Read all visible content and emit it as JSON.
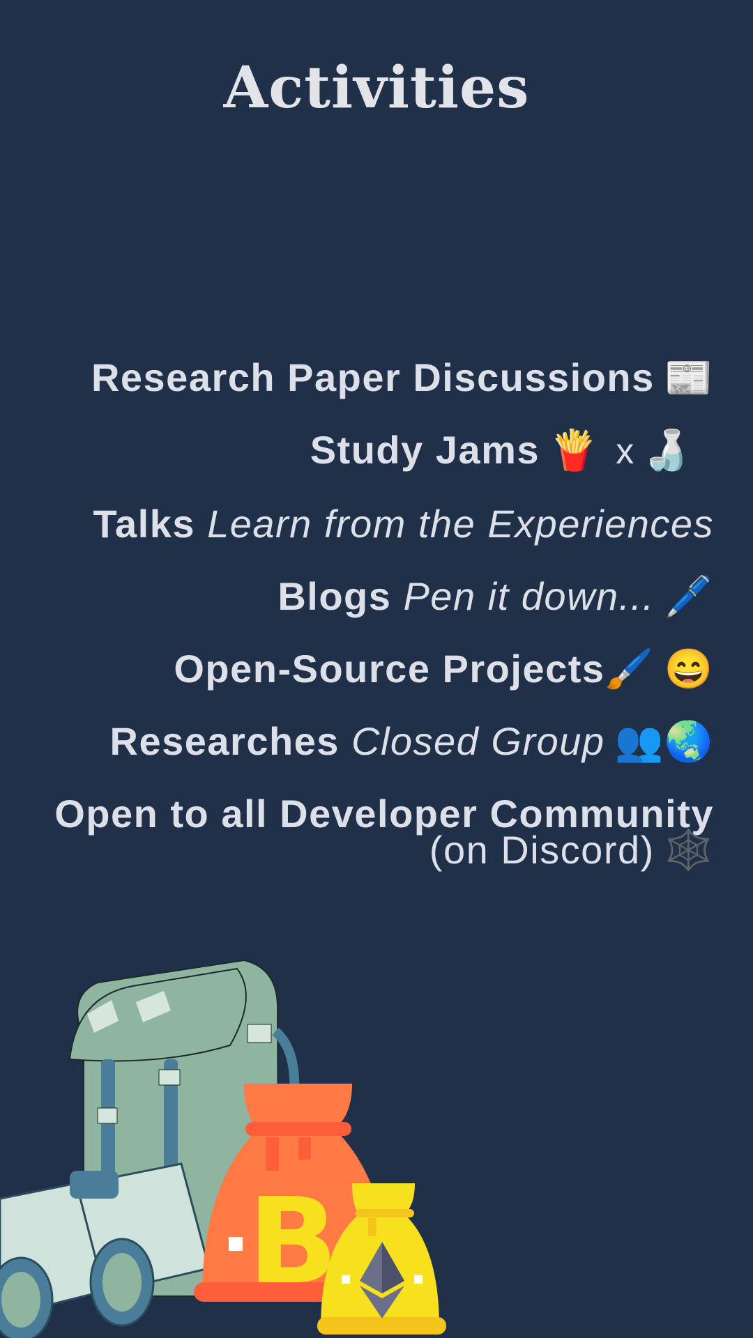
{
  "header": {
    "title": "Activities"
  },
  "activities": [
    {
      "bold": "Research Paper Discussions",
      "emoji": "📰"
    },
    {
      "bold": "Study Jams",
      "emoji": "🍟",
      "joiner": "x",
      "emoji2": "🍶"
    },
    {
      "bold": "Talks",
      "italic": "Learn from the Experiences"
    },
    {
      "bold": "Blogs",
      "italic": "Pen it down...",
      "emoji": "🖊️"
    },
    {
      "bold": "Open-Source Projects",
      "emoji": "🖌️",
      "emoji2": "😄"
    },
    {
      "bold": "Researches",
      "italic": "Closed Group",
      "emoji": "👥",
      "emoji2": "🌏"
    },
    {
      "bold": "Open to all Developer Community",
      "normal": "(on Discord)",
      "emoji": "🕸️"
    }
  ],
  "illustration": {
    "icons": [
      "backpack-icon",
      "binoculars-icon",
      "bitcoin-bag-icon",
      "ethereum-bag-icon"
    ],
    "colors": {
      "backpack": "#8fb5a1",
      "bitcoin_bag": "#ff7a45",
      "ethereum_bag": "#f7e11f",
      "coin": "#f7e11f"
    }
  }
}
